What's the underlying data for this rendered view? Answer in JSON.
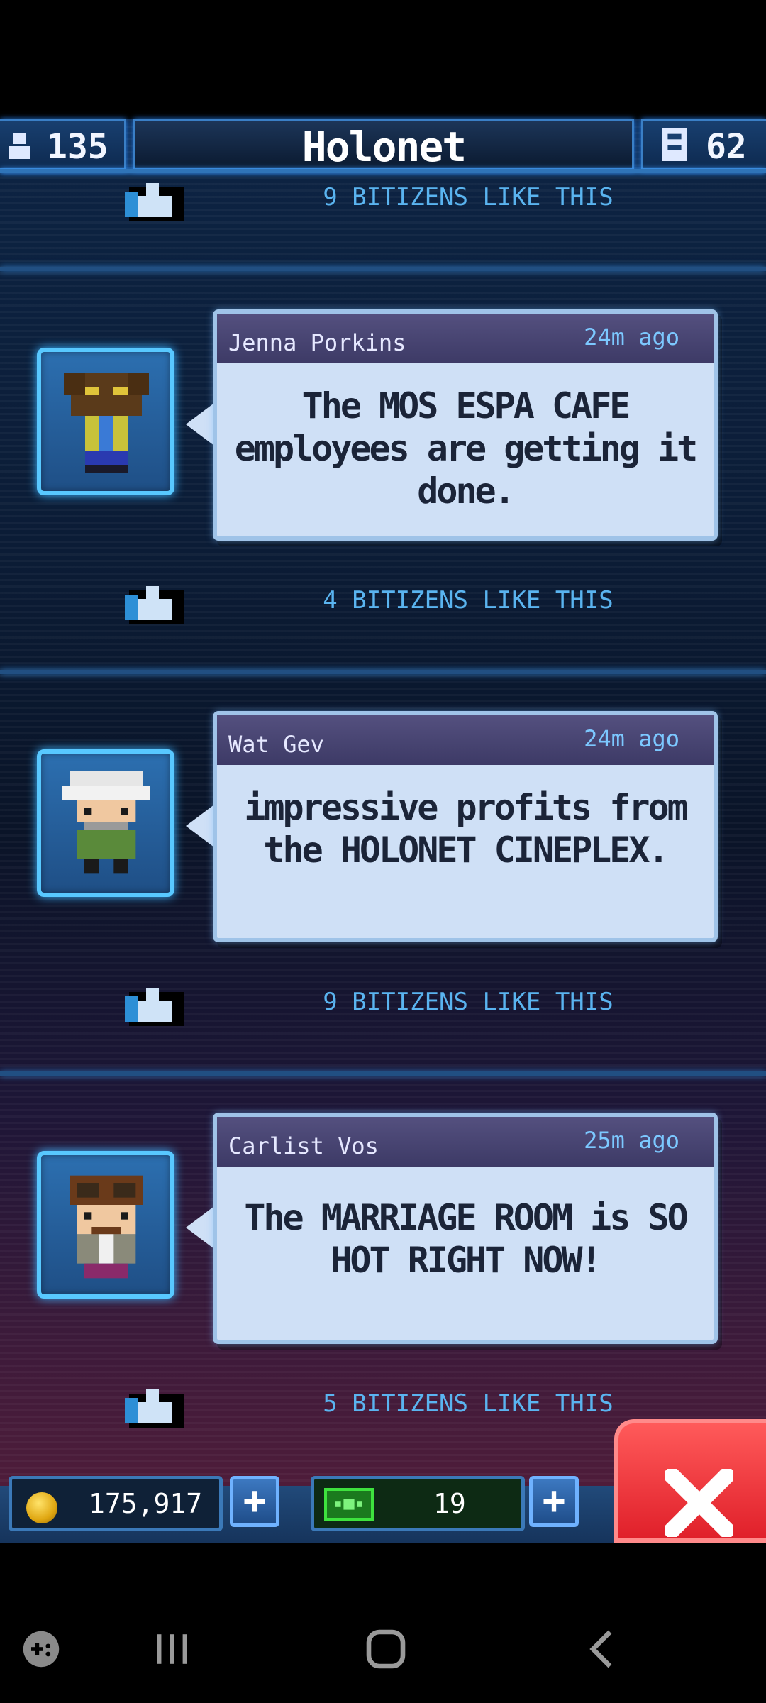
{
  "header": {
    "population": "135",
    "title": "Holonet",
    "floors": "62"
  },
  "feed": {
    "first_likes": "9 BITIZENS LIKE THIS",
    "posts": [
      {
        "name": "Jenna Porkins",
        "time": "24m ago",
        "message": "The MOS ESPA CAFE employees are getting it done.",
        "likes": "4 BITIZENS LIKE THIS"
      },
      {
        "name": "Wat Gev",
        "time": "24m ago",
        "message": "impressive profits from the HOLONET CINEPLEX.",
        "likes": "9 BITIZENS LIKE THIS"
      },
      {
        "name": "Carlist Vos",
        "time": "25m ago",
        "message": "The MARRIAGE ROOM is SO HOT RIGHT NOW!",
        "likes": "5 BITIZENS LIKE THIS"
      }
    ]
  },
  "resources": {
    "coins": "175,917",
    "bux": "19",
    "plus_label": "+"
  },
  "colors": {
    "accent_blue": "#58c8ff",
    "close_red": "#e0202a",
    "likes_text": "#5ab4f0"
  },
  "icons": {
    "population": "person-icon",
    "floors": "building-icon",
    "like": "thumbs-up-icon",
    "coin": "coin-icon",
    "bux": "bux-icon",
    "close": "close-icon",
    "game_launcher": "game-launcher-icon",
    "recents": "recents-icon",
    "home": "home-icon",
    "back": "back-icon"
  }
}
